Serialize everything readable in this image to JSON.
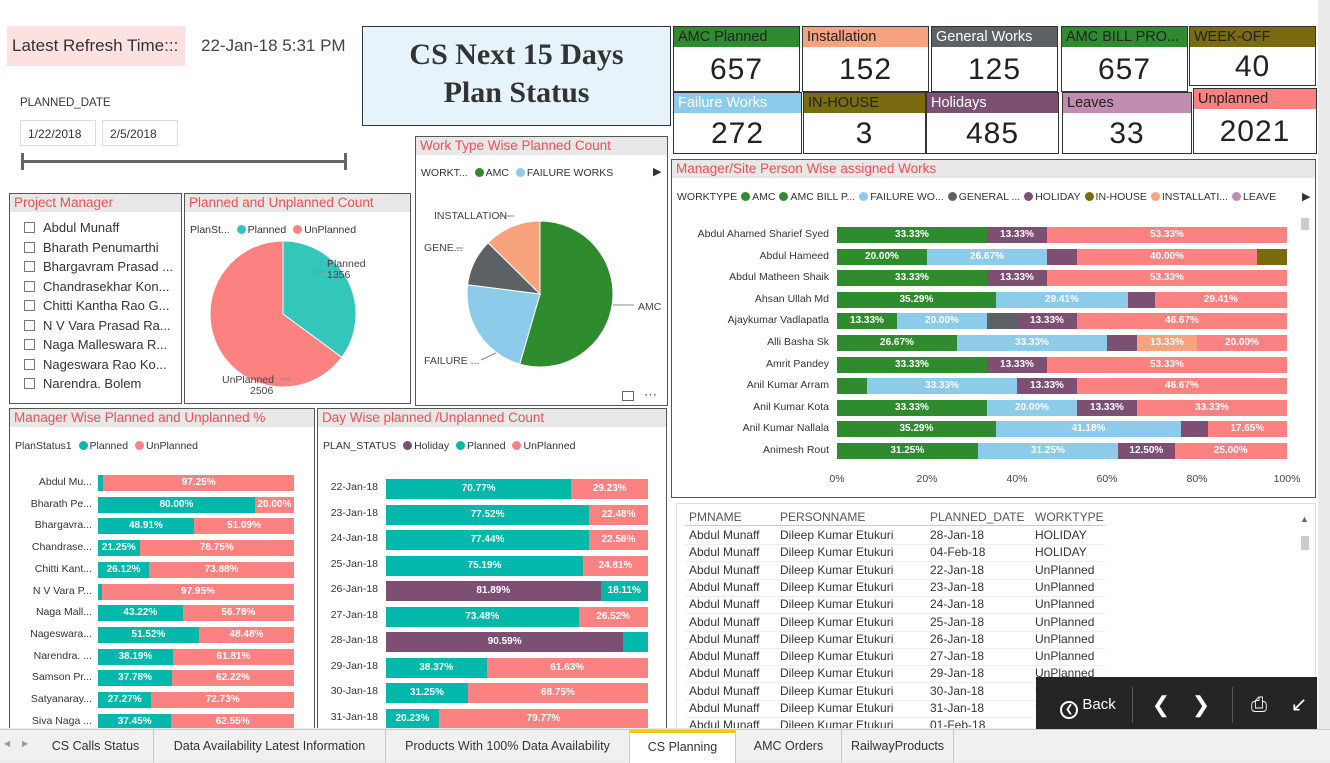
{
  "refresh": {
    "label": "Latest Refresh Time:::",
    "value": "22-Jan-18 5:31 PM"
  },
  "slicer": {
    "label": "PLANNED_DATE",
    "start": "1/22/2018",
    "end": "2/5/2018"
  },
  "title": {
    "line1": "CS Next 15 Days",
    "line2": "Plan Status"
  },
  "cards": [
    {
      "label": "AMC Planned",
      "value": "657",
      "color": "#2e8b2e",
      "textcolor": "#222"
    },
    {
      "label": "Installation",
      "value": "152",
      "color": "#f8a37e",
      "textcolor": "#222"
    },
    {
      "label": "General Works",
      "value": "125",
      "color": "#5c6263",
      "textcolor": "#fff"
    },
    {
      "label": "AMC BILL PRO...",
      "value": "657",
      "color": "#2e8b2e",
      "textcolor": "#222"
    },
    {
      "label": "WEEK-OFF",
      "value": "40",
      "color": "#7a6a10",
      "textcolor": "#222"
    },
    {
      "label": "Failure Works",
      "value": "272",
      "color": "#8ccbea",
      "textcolor": "#fff"
    },
    {
      "label": "IN-HOUSE",
      "value": "3",
      "color": "#7a6a10",
      "textcolor": "#222"
    },
    {
      "label": "Holidays",
      "value": "485",
      "color": "#7d4f73",
      "textcolor": "#fff"
    },
    {
      "label": "Leaves",
      "value": "33",
      "color": "#c08db0",
      "textcolor": "#222"
    },
    {
      "label": "Unplanned",
      "value": "2021",
      "color": "#fb8281",
      "textcolor": "#222"
    }
  ],
  "project_manager": {
    "title": "Project Manager",
    "items": [
      "Abdul Munaff",
      "Bharath Penumarthi",
      "Bhargavram Prasad ...",
      "Chandrasekhar Kon...",
      "Chitti Kantha Rao G...",
      "N V Vara Prasad Ra...",
      "Naga Malleswara R...",
      "Nageswara Rao Ko...",
      "Narendra. Bolem"
    ]
  },
  "colors": {
    "planned": "#34c6bb",
    "unplanned": "#fb8281",
    "holiday": "#7d4f73",
    "amc": "#2e8b2e",
    "amc_bill": "#2e8b2e",
    "failure": "#8ccbea",
    "general": "#5c6263",
    "inhouse": "#7a6a10",
    "installation": "#f8a37e",
    "leave": "#c08db0",
    "teal": "#01b8aa"
  },
  "pie1": {
    "title": "Planned and Unplanned Count",
    "legend_title": "PlanSt...",
    "legend": [
      "Planned",
      "UnPlanned"
    ],
    "labels": [
      {
        "name": "Planned",
        "value": "1356"
      },
      {
        "name": "UnPlanned",
        "value": "2506"
      }
    ]
  },
  "pie2": {
    "title": "Work Type Wise Planned Count",
    "legend_title": "WORKT...",
    "legend": [
      "AMC",
      "FAILURE WORKS"
    ],
    "labels": [
      "INSTALLATION",
      "GENE...",
      "AMC",
      "FAILURE ..."
    ]
  },
  "manager_site": {
    "title": "Manager/Site Person Wise assigned Works",
    "legend_title": "WORKTYPE",
    "legend": [
      "AMC",
      "AMC BILL P...",
      "FAILURE WO...",
      "GENERAL ...",
      "HOLIDAY",
      "IN-HOUSE",
      "INSTALLATI...",
      "LEAVE"
    ],
    "axis": [
      "0%",
      "20%",
      "40%",
      "60%",
      "80%",
      "100%"
    ]
  },
  "mgr_pct": {
    "title": "Manager Wise Planned and Unplanned %",
    "legend_title": "PlanStatus1",
    "legend": [
      "Planned",
      "UnPlanned"
    ]
  },
  "day_wise": {
    "title": "Day Wise planned /Unplanned Count",
    "legend_title": "PLAN_STATUS",
    "legend": [
      "Holiday",
      "Planned",
      "UnPlanned"
    ]
  },
  "table": {
    "headers": [
      "PMNAME",
      "PERSONNAME",
      "PLANNED_DATE",
      "WORKTYPE"
    ],
    "rows": [
      [
        "Abdul Munaff",
        "Dileep Kumar Etukuri",
        "28-Jan-18",
        "HOLIDAY"
      ],
      [
        "Abdul Munaff",
        "Dileep Kumar Etukuri",
        "04-Feb-18",
        "HOLIDAY"
      ],
      [
        "Abdul Munaff",
        "Dileep Kumar Etukuri",
        "22-Jan-18",
        "UnPlanned"
      ],
      [
        "Abdul Munaff",
        "Dileep Kumar Etukuri",
        "23-Jan-18",
        "UnPlanned"
      ],
      [
        "Abdul Munaff",
        "Dileep Kumar Etukuri",
        "24-Jan-18",
        "UnPlanned"
      ],
      [
        "Abdul Munaff",
        "Dileep Kumar Etukuri",
        "25-Jan-18",
        "UnPlanned"
      ],
      [
        "Abdul Munaff",
        "Dileep Kumar Etukuri",
        "26-Jan-18",
        "UnPlanned"
      ],
      [
        "Abdul Munaff",
        "Dileep Kumar Etukuri",
        "27-Jan-18",
        "UnPlanned"
      ],
      [
        "Abdul Munaff",
        "Dileep Kumar Etukuri",
        "29-Jan-18",
        "UnPlanned"
      ],
      [
        "Abdul Munaff",
        "Dileep Kumar Etukuri",
        "30-Jan-18",
        "UnPlanned"
      ],
      [
        "Abdul Munaff",
        "Dileep Kumar Etukuri",
        "31-Jan-18",
        "UnPlanned"
      ],
      [
        "Abdul Munaff",
        "Dileep Kumar Etukuri",
        "01-Feb-18",
        "UnPlanned"
      ]
    ]
  },
  "nav": {
    "back": "Back"
  },
  "tabs": [
    "CS Calls Status",
    "Data Availability Latest Information",
    "Products With 100% Data Availability",
    "CS Planning",
    "AMC Orders",
    "RailwayProducts"
  ],
  "chart_data": [
    {
      "type": "pie",
      "title": "Planned and Unplanned Count",
      "categories": [
        "Planned",
        "UnPlanned"
      ],
      "values": [
        1356,
        2506
      ]
    },
    {
      "type": "pie",
      "title": "Work Type Wise Planned Count",
      "categories": [
        "AMC",
        "FAILURE WORKS",
        "GENERAL WORKS",
        "INSTALLATION"
      ],
      "values": [
        657,
        272,
        125,
        152
      ]
    },
    {
      "type": "bar",
      "title": "Manager Wise Planned and Unplanned %",
      "categories": [
        "Abdul Mu...",
        "Bharath Pe...",
        "Bhargavra...",
        "Chandrase...",
        "Chitti Kant...",
        "N V Vara P...",
        "Naga Mall...",
        "Nageswara...",
        "Narendra. ...",
        "Samson Pr...",
        "Satyanaray...",
        "Siva Naga ..."
      ],
      "series": [
        {
          "name": "Planned",
          "values": [
            2.75,
            80.0,
            48.91,
            21.25,
            26.12,
            2.05,
            43.22,
            51.52,
            38.19,
            37.78,
            27.27,
            37.45
          ],
          "labels": [
            "",
            "80.00%",
            "48.91%",
            "21.25%",
            "26.12%",
            "",
            "43.22%",
            "51.52%",
            "38.19%",
            "37.78%",
            "27.27%",
            "37.45%"
          ]
        },
        {
          "name": "UnPlanned",
          "values": [
            97.25,
            20.0,
            51.09,
            78.75,
            73.88,
            97.95,
            56.78,
            48.48,
            61.81,
            62.22,
            72.73,
            62.55
          ],
          "labels": [
            "97.25%",
            "20.00%",
            "51.09%",
            "78.75%",
            "73.88%",
            "97.95%",
            "56.78%",
            "48.48%",
            "61.81%",
            "62.22%",
            "72.73%",
            "62.55%"
          ]
        }
      ]
    },
    {
      "type": "bar",
      "title": "Day Wise planned /Unplanned Count",
      "categories": [
        "22-Jan-18",
        "23-Jan-18",
        "24-Jan-18",
        "25-Jan-18",
        "26-Jan-18",
        "27-Jan-18",
        "28-Jan-18",
        "29-Jan-18",
        "30-Jan-18",
        "31-Jan-18"
      ],
      "series": [
        {
          "name": "Holiday",
          "values": [
            0,
            0,
            0,
            0,
            81.89,
            0,
            90.59,
            0,
            0,
            0
          ],
          "labels": [
            "",
            "",
            "",
            "",
            "81.89%",
            "",
            "90.59%",
            "",
            "",
            ""
          ]
        },
        {
          "name": "Planned",
          "values": [
            70.77,
            77.52,
            77.44,
            75.19,
            18.11,
            73.48,
            9.41,
            38.37,
            31.25,
            20.23
          ],
          "labels": [
            "70.77%",
            "77.52%",
            "77.44%",
            "75.19%",
            "18.11%",
            "73.48%",
            "",
            "38.37%",
            "31.25%",
            "20.23%"
          ]
        },
        {
          "name": "UnPlanned",
          "values": [
            29.23,
            22.48,
            22.56,
            24.81,
            0,
            26.52,
            0,
            61.63,
            68.75,
            79.77
          ],
          "labels": [
            "29.23%",
            "22.48%",
            "22.56%",
            "24.81%",
            "",
            "26.52%",
            "",
            "61.63%",
            "68.75%",
            "79.77%"
          ]
        }
      ]
    },
    {
      "type": "bar",
      "title": "Manager/Site Person Wise assigned Works",
      "categories": [
        "Abdul Ahamed Sharief Syed",
        "Abdul Hameed",
        "Abdul Matheen Shaik",
        "Ahsan Ullah Md",
        "Ajaykumar Vadlapatla",
        "Alli Basha Sk",
        "Amrit Pandey",
        "Anil Kumar Arram",
        "Anil Kumar Kota",
        "Anil Kumar Nallala",
        "Animesh Rout"
      ],
      "rows": [
        [
          {
            "k": "amc",
            "v": 33.33,
            "l": "33.33%"
          },
          {
            "k": "holiday",
            "v": 13.33,
            "l": "13.33%"
          },
          {
            "k": "unplanned",
            "v": 53.34,
            "l": "53.33%"
          }
        ],
        [
          {
            "k": "amc",
            "v": 20,
            "l": "20.00%"
          },
          {
            "k": "failure",
            "v": 26.67,
            "l": "26.67%"
          },
          {
            "k": "holiday",
            "v": 6.67,
            "l": ""
          },
          {
            "k": "unplanned",
            "v": 40,
            "l": "40.00%"
          },
          {
            "k": "inhouse",
            "v": 6.66,
            "l": ""
          }
        ],
        [
          {
            "k": "amc",
            "v": 33.33,
            "l": "33.33%"
          },
          {
            "k": "holiday",
            "v": 13.33,
            "l": "13.33%"
          },
          {
            "k": "unplanned",
            "v": 53.34,
            "l": "53.33%"
          }
        ],
        [
          {
            "k": "amc",
            "v": 35.29,
            "l": "35.29%"
          },
          {
            "k": "failure",
            "v": 29.41,
            "l": "29.41%"
          },
          {
            "k": "holiday",
            "v": 5.89,
            "l": ""
          },
          {
            "k": "unplanned",
            "v": 29.41,
            "l": "29.41%"
          }
        ],
        [
          {
            "k": "amc",
            "v": 13.33,
            "l": "13.33%"
          },
          {
            "k": "failure",
            "v": 20,
            "l": "20.00%"
          },
          {
            "k": "general",
            "v": 6.67,
            "l": ""
          },
          {
            "k": "holiday",
            "v": 13.33,
            "l": "13.33%"
          },
          {
            "k": "unplanned",
            "v": 46.67,
            "l": "46.67%"
          }
        ],
        [
          {
            "k": "amc",
            "v": 26.67,
            "l": "26.67%"
          },
          {
            "k": "failure",
            "v": 33.33,
            "l": "33.33%"
          },
          {
            "k": "holiday",
            "v": 6.67,
            "l": ""
          },
          {
            "k": "installation",
            "v": 13.33,
            "l": "13.33%"
          },
          {
            "k": "unplanned",
            "v": 20,
            "l": "20.00%"
          }
        ],
        [
          {
            "k": "amc",
            "v": 33.33,
            "l": "33.33%"
          },
          {
            "k": "holiday",
            "v": 13.33,
            "l": "13.33%"
          },
          {
            "k": "unplanned",
            "v": 53.34,
            "l": "53.33%"
          }
        ],
        [
          {
            "k": "amc",
            "v": 6.67,
            "l": ""
          },
          {
            "k": "failure",
            "v": 33.33,
            "l": "33.33%"
          },
          {
            "k": "holiday",
            "v": 13.33,
            "l": "13.33%"
          },
          {
            "k": "unplanned",
            "v": 46.67,
            "l": "46.67%"
          }
        ],
        [
          {
            "k": "amc",
            "v": 33.33,
            "l": "33.33%"
          },
          {
            "k": "failure",
            "v": 20,
            "l": "20.00%"
          },
          {
            "k": "holiday",
            "v": 13.33,
            "l": "13.33%"
          },
          {
            "k": "unplanned",
            "v": 33.34,
            "l": "33.33%"
          }
        ],
        [
          {
            "k": "amc",
            "v": 35.29,
            "l": "35.29%"
          },
          {
            "k": "failure",
            "v": 41.18,
            "l": "41.18%"
          },
          {
            "k": "holiday",
            "v": 5.88,
            "l": ""
          },
          {
            "k": "unplanned",
            "v": 17.65,
            "l": "17.65%"
          }
        ],
        [
          {
            "k": "amc",
            "v": 31.25,
            "l": "31.25%"
          },
          {
            "k": "failure",
            "v": 31.25,
            "l": "31.25%"
          },
          {
            "k": "holiday",
            "v": 12.5,
            "l": "12.50%"
          },
          {
            "k": "unplanned",
            "v": 25,
            "l": "25.00%"
          }
        ]
      ]
    }
  ]
}
